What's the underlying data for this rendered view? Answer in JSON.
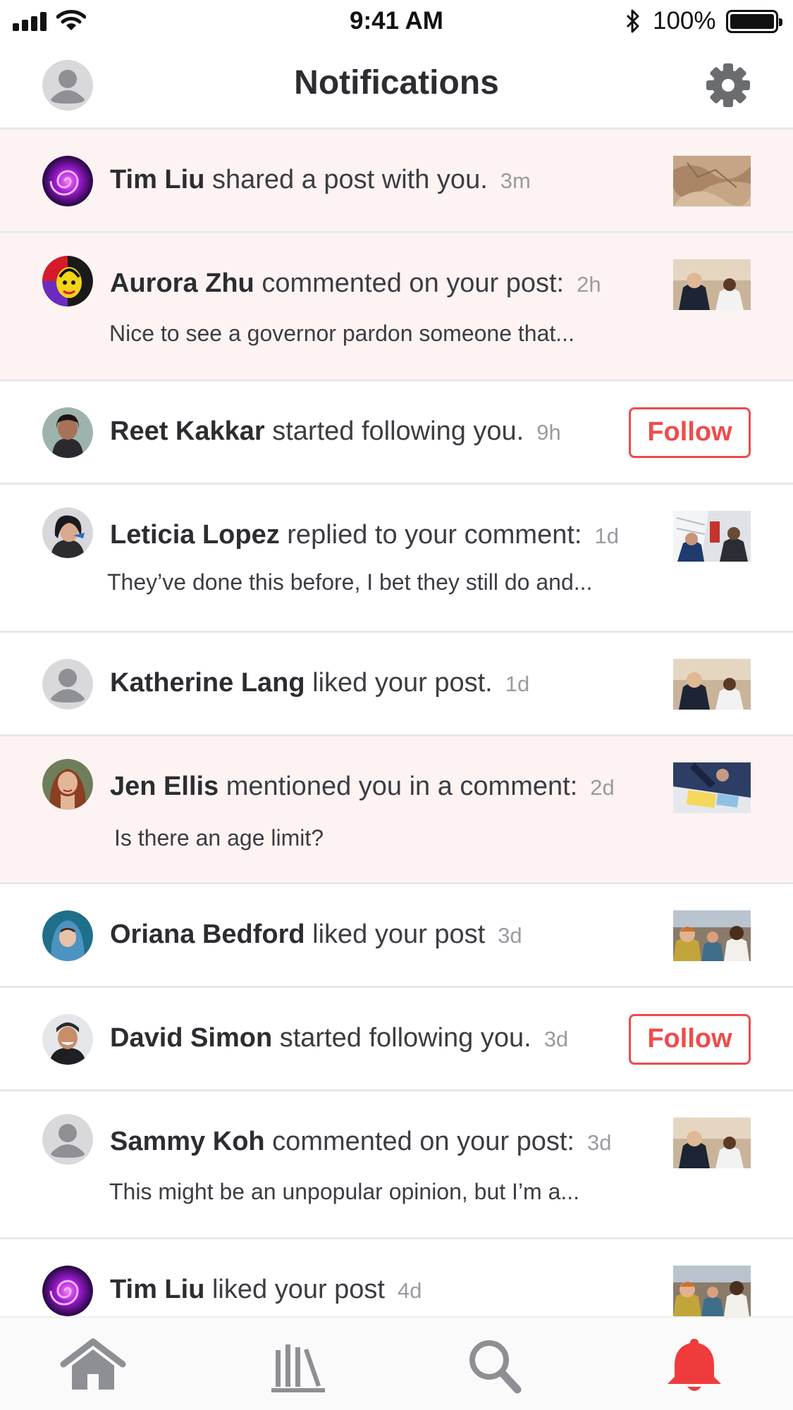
{
  "status_bar": {
    "time": "9:41 AM",
    "battery_percent": "100%",
    "icons": [
      "signal-icon",
      "wifi-icon",
      "bluetooth-icon",
      "battery-icon"
    ]
  },
  "header": {
    "title": "Notifications",
    "icons": [
      "avatar-placeholder-icon",
      "gear-icon"
    ]
  },
  "colors": {
    "accent": "#ef4b4b",
    "unread_background": "#fdf3f3",
    "divider": "#e8e8ea",
    "text": "#333438",
    "muted": "#9a9ba0"
  },
  "notifications": [
    {
      "name": "Tim Liu",
      "action": " shared a post with you.",
      "time": "3m",
      "preview": "",
      "unread": true,
      "avatar": "purple-swirl-avatar",
      "thumbnail": "desert-aerial-thumbnail"
    },
    {
      "name": "Aurora Zhu",
      "action": " commented on your post:",
      "time": "2h",
      "preview": "Nice to see a governor pardon someone that...",
      "unread": true,
      "avatar": "pop-art-avatar",
      "thumbnail": "governor-photo-thumbnail"
    },
    {
      "name": "Reet Kakkar",
      "action": " started following you.",
      "time": "9h",
      "preview": "",
      "unread": false,
      "avatar": "photo-avatar",
      "follow_label": "Follow"
    },
    {
      "name": "Leticia Lopez",
      "action": " replied to your comment:",
      "time": "1d",
      "preview": "They’ve done this before, I bet they still do and...",
      "unread": false,
      "avatar": "photo-avatar",
      "thumbnail": "office-photo-thumbnail"
    },
    {
      "name": "Katherine Lang",
      "action": " liked your post.",
      "time": "1d",
      "preview": "",
      "unread": false,
      "avatar": "placeholder-avatar",
      "thumbnail": "governor-photo-thumbnail"
    },
    {
      "name": "Jen Ellis",
      "action": " mentioned you in a comment:",
      "time": "2d",
      "preview": "Is there an age limit?",
      "unread": true,
      "avatar": "photo-avatar",
      "thumbnail": "desk-photo-thumbnail"
    },
    {
      "name": "Oriana Bedford",
      "action": " liked your post",
      "time": "3d",
      "preview": "",
      "unread": false,
      "avatar": "photo-avatar",
      "thumbnail": "crowd-photo-thumbnail"
    },
    {
      "name": "David Simon",
      "action": " started following you.",
      "time": "3d",
      "preview": "",
      "unread": false,
      "avatar": "photo-avatar",
      "follow_label": "Follow"
    },
    {
      "name": "Sammy Koh",
      "action": " commented on your post:",
      "time": "3d",
      "preview": "This might be an unpopular opinion, but I’m a...",
      "unread": false,
      "avatar": "placeholder-avatar",
      "thumbnail": "governor-photo-thumbnail"
    },
    {
      "name": "Tim Liu",
      "action": " liked your post",
      "time": "4d",
      "preview": "",
      "unread": false,
      "avatar": "purple-swirl-avatar",
      "thumbnail": "crowd-photo-thumbnail"
    }
  ],
  "tabbar": {
    "tabs": [
      "home-icon",
      "library-icon",
      "search-icon",
      "bell-icon"
    ],
    "active": "bell-icon"
  }
}
